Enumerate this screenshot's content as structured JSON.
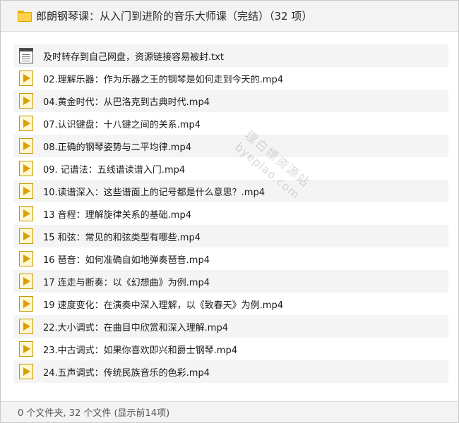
{
  "window": {
    "title": "郎朗钢琴课：从入门到进阶的音乐大师课（完结）（32 项）"
  },
  "files": [
    {
      "name": "及时转存到自己网盘，资源链接容易被封.txt",
      "icon": "txt-file-icon"
    },
    {
      "name": "02.理解乐器：作为乐器之王的钢琴是如何走到今天的.mp4",
      "icon": "video-file-icon"
    },
    {
      "name": "04.黄金时代：从巴洛克到古典时代.mp4",
      "icon": "video-file-icon"
    },
    {
      "name": "07.认识键盘：十八键之间的关系.mp4",
      "icon": "video-file-icon"
    },
    {
      "name": "08.正确的钢琴姿势与二平均律.mp4",
      "icon": "video-file-icon"
    },
    {
      "name": "09. 记谱法：五线谱读谱入门.mp4",
      "icon": "video-file-icon"
    },
    {
      "name": "10.读谱深入：这些谱面上的记号都是什么意思？.mp4",
      "icon": "video-file-icon"
    },
    {
      "name": "13 音程：理解旋律关系的基础.mp4",
      "icon": "video-file-icon"
    },
    {
      "name": "15 和弦：常见的和弦类型有哪些.mp4",
      "icon": "video-file-icon"
    },
    {
      "name": "16 琶音：如何准确自如地弹奏琶音.mp4",
      "icon": "video-file-icon"
    },
    {
      "name": "17 连走与断奏：以《幻想曲》为例.mp4",
      "icon": "video-file-icon"
    },
    {
      "name": "19 速度变化：在演奏中深入理解，以《致春天》为例.mp4",
      "icon": "video-file-icon"
    },
    {
      "name": "22.大小调式：在曲目中欣赏和深入理解.mp4",
      "icon": "video-file-icon"
    },
    {
      "name": "23.中古调式：如果你喜欢即兴和爵士钢琴.mp4",
      "icon": "video-file-icon"
    },
    {
      "name": "24.五声调式：传统民族音乐的色彩.mp4",
      "icon": "video-file-icon"
    }
  ],
  "watermark": {
    "line1": "理白嫖资源站",
    "line2": "byepiao.com"
  },
  "status": {
    "text": "0 个文件夹, 32 个文件 (显示前14项)"
  },
  "colors": {
    "row_alt": "#f4f4f4",
    "folder": "#ffd24a",
    "video_icon": "#d9a000"
  }
}
